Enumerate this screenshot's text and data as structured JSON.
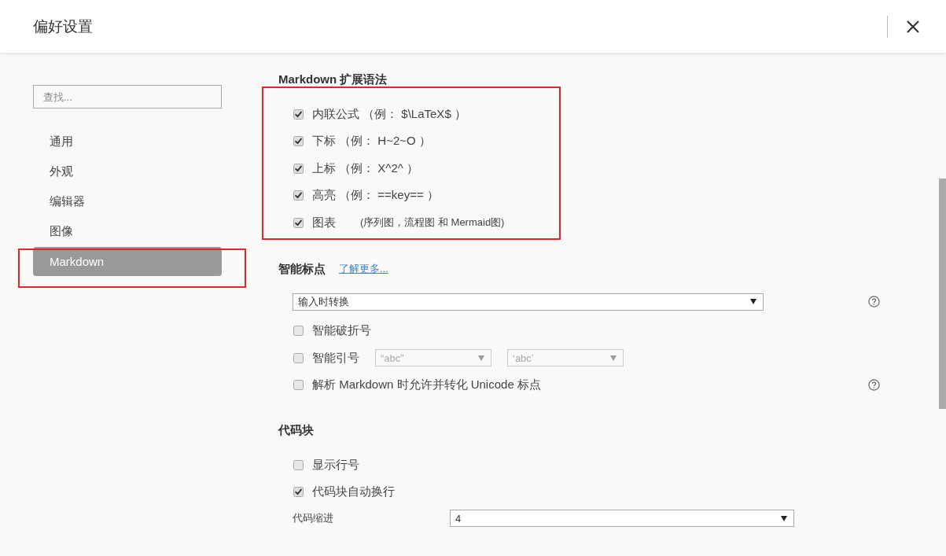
{
  "window": {
    "title": "偏好设置"
  },
  "sidebar": {
    "search": {
      "placeholder": "查找..."
    },
    "items": [
      {
        "label": "通用",
        "selected": false,
        "highlighted": false
      },
      {
        "label": "外观",
        "selected": false,
        "highlighted": false
      },
      {
        "label": "编辑器",
        "selected": false,
        "highlighted": false
      },
      {
        "label": "图像",
        "selected": false,
        "highlighted": false
      },
      {
        "label": "Markdown",
        "selected": true,
        "highlighted": true
      }
    ]
  },
  "sections": [
    {
      "title": "Markdown 扩展语法",
      "highlighted": true,
      "rows": [
        {
          "kind": "checkbox",
          "label": "内联公式 （例： $\\LaTeX$ ）",
          "checked": true
        },
        {
          "kind": "checkbox",
          "label": "下标 （例： H~2~O ）",
          "checked": true
        },
        {
          "kind": "checkbox",
          "label": "上标 （例： X^2^ ）",
          "checked": true
        },
        {
          "kind": "checkbox",
          "label": "高亮 （例： ==key== ）",
          "checked": true
        },
        {
          "kind": "checkbox",
          "label": "图表",
          "note": "(序列图，流程图 和 Mermaid图)",
          "checked": true
        }
      ]
    },
    {
      "title": "智能标点",
      "link": "了解更多...",
      "highlighted": false,
      "rows": [
        {
          "kind": "select",
          "value": "输入时转换",
          "help": true
        },
        {
          "kind": "checkbox",
          "label": "智能破折号",
          "checked": false,
          "help": false
        },
        {
          "kind": "checkbox",
          "label": "智能引号",
          "checked": false,
          "help": false,
          "selects": [
            {
              "value": "“abc”",
              "disabled": true
            },
            {
              "value": "‘abc’",
              "disabled": true
            }
          ]
        },
        {
          "kind": "checkbox",
          "label": "解析 Markdown 时允许并转化 Unicode 标点",
          "checked": false,
          "help": true
        }
      ]
    },
    {
      "title": "代码块",
      "highlighted": false,
      "rows": [
        {
          "kind": "checkbox",
          "label": "显示行号",
          "checked": false
        },
        {
          "kind": "checkbox",
          "label": "代码块自动换行",
          "checked": true
        },
        {
          "kind": "labeled-select",
          "label": "代码缩进",
          "value": "4"
        }
      ]
    }
  ]
}
